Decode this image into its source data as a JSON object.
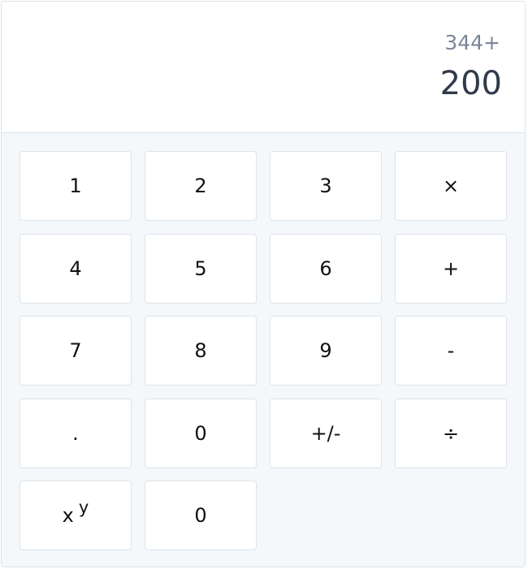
{
  "display": {
    "expression": "344+",
    "result": "200"
  },
  "keys": {
    "one": "1",
    "two": "2",
    "three": "3",
    "multiply": "×",
    "four": "4",
    "five": "5",
    "six": "6",
    "plus": "+",
    "seven": "7",
    "eight": "8",
    "nine": "9",
    "minus": "-",
    "decimal": ".",
    "zero": "0",
    "negate": "+/-",
    "divide": "÷",
    "power_base": "x",
    "power_exp": "y",
    "zero_second": "0"
  }
}
